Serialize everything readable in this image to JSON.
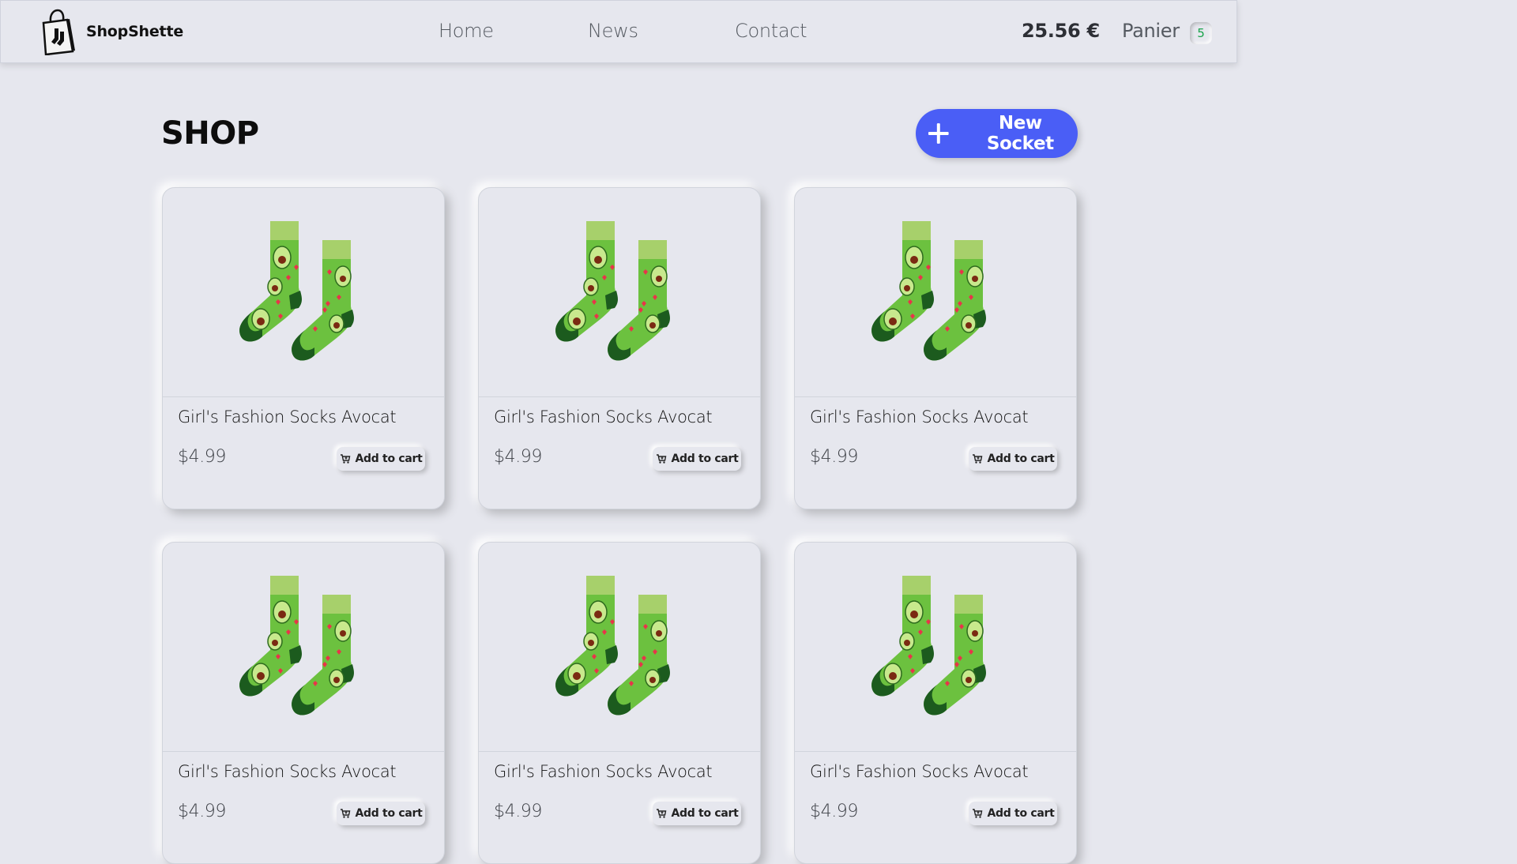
{
  "brand": {
    "name": "ShopShette",
    "logo_icon": "shopping-bag-socks-icon"
  },
  "nav": {
    "links": [
      {
        "label": "Home"
      },
      {
        "label": "News"
      },
      {
        "label": "Contact"
      }
    ],
    "cart_total": "25.56 €",
    "panier_label": "Panier",
    "panier_count": "5"
  },
  "page": {
    "title": "SHOP",
    "new_button_label": "New Socket",
    "new_button_icon": "plus-icon",
    "accent_color": "#4a5ef6"
  },
  "products": [
    {
      "name": "Girl's Fashion Socks Avocat",
      "price": "$4.99",
      "cta": "Add to cart",
      "image": "avocado-socks"
    },
    {
      "name": "Girl's Fashion Socks Avocat",
      "price": "$4.99",
      "cta": "Add to cart",
      "image": "avocado-socks"
    },
    {
      "name": "Girl's Fashion Socks Avocat",
      "price": "$4.99",
      "cta": "Add to cart",
      "image": "avocado-socks"
    },
    {
      "name": "Girl's Fashion Socks Avocat",
      "price": "$4.99",
      "cta": "Add to cart",
      "image": "avocado-socks"
    },
    {
      "name": "Girl's Fashion Socks Avocat",
      "price": "$4.99",
      "cta": "Add to cart",
      "image": "avocado-socks"
    },
    {
      "name": "Girl's Fashion Socks Avocat",
      "price": "$4.99",
      "cta": "Add to cart",
      "image": "avocado-socks"
    }
  ]
}
